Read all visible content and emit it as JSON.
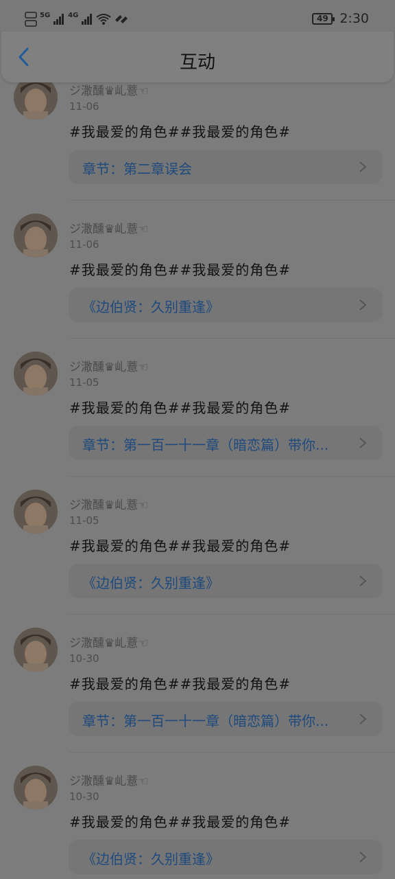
{
  "status_bar": {
    "network_5g": "5G",
    "network_4g": "4G",
    "battery": "49",
    "time": "2:30"
  },
  "header": {
    "title": "互动"
  },
  "feed": [
    {
      "username": "ジ潵醺♛乢薏☜",
      "date": "11-06",
      "content": "#我最爱的角色##我最爱的角色#",
      "link": "章节：第二章误会"
    },
    {
      "username": "ジ潵醺♛乢薏☜",
      "date": "11-06",
      "content": "#我最爱的角色##我最爱的角色#",
      "link": "《边伯贤：久别重逢》"
    },
    {
      "username": "ジ潵醺♛乢薏☜",
      "date": "11-05",
      "content": "#我最爱的角色##我最爱的角色#",
      "link": "章节：第一百一十一章（暗恋篇）带你..."
    },
    {
      "username": "ジ潵醺♛乢薏☜",
      "date": "11-05",
      "content": "#我最爱的角色##我最爱的角色#",
      "link": "《边伯贤：久别重逢》"
    },
    {
      "username": "ジ潵醺♛乢薏☜",
      "date": "10-30",
      "content": "#我最爱的角色##我最爱的角色#",
      "link": "章节：第一百一十一章（暗恋篇）带你..."
    },
    {
      "username": "ジ潵醺♛乢薏☜",
      "date": "10-30",
      "content": "#我最爱的角色##我最爱的角色#",
      "link": "《边伯贤：久别重逢》"
    }
  ],
  "icons": {
    "back": "chevron-left-icon",
    "link_arrow": "chevron-right-icon"
  },
  "colors": {
    "overlay_bg": "#7c7c7c",
    "link_text": "#1e4a7e",
    "back_arrow": "#1f5a9a"
  }
}
